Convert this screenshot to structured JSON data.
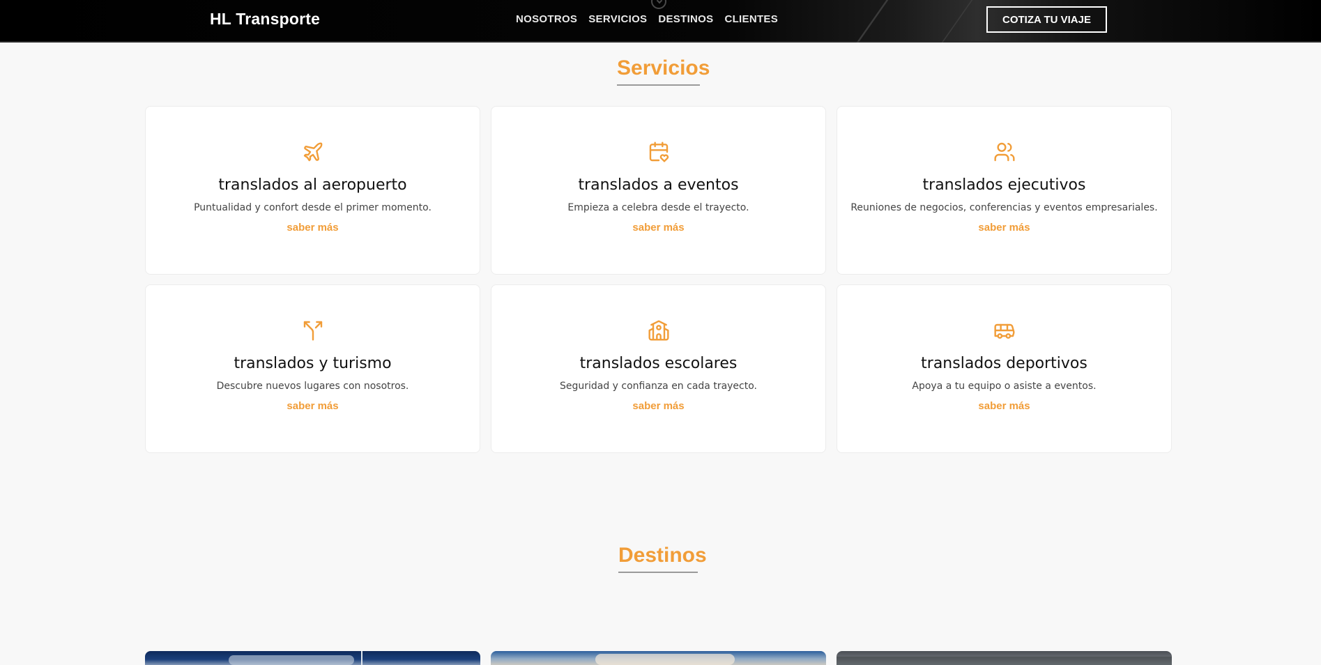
{
  "nav": {
    "brand": "HL Transporte",
    "links": [
      "NOSOTROS",
      "SERVICIOS",
      "DESTINOS",
      "CLIENTES"
    ],
    "cta_label": "COTIZA TU VIAJE"
  },
  "servicios": {
    "title": "Servicios",
    "cards": [
      {
        "icon": "plane-icon",
        "title": "translados al aeropuerto",
        "desc": "Puntualidad y confort desde el primer momento.",
        "link": "saber más"
      },
      {
        "icon": "calendar-heart-icon",
        "title": "translados a eventos",
        "desc": "Empieza a celebra desde el trayecto.",
        "link": "saber más"
      },
      {
        "icon": "users-icon",
        "title": "translados ejecutivos",
        "desc": "Reuniones de negocios, conferencias y eventos empresariales.",
        "link": "saber más"
      },
      {
        "icon": "split-arrow-icon",
        "title": "translados y turismo",
        "desc": "Descubre nuevos lugares con nosotros.",
        "link": "saber más"
      },
      {
        "icon": "school-icon",
        "title": "translados escolares",
        "desc": "Seguridad y confianza en cada trayecto.",
        "link": "saber más"
      },
      {
        "icon": "bus-icon",
        "title": "translados deportivos",
        "desc": "Apoya a tu equipo o asiste a eventos.",
        "link": "saber más"
      }
    ]
  },
  "destinos": {
    "title": "Destinos"
  },
  "colors": {
    "accent": "#f19d38",
    "nav_bg": "#000000",
    "page_bg": "#f8f8f8",
    "card_bg": "#ffffff"
  }
}
